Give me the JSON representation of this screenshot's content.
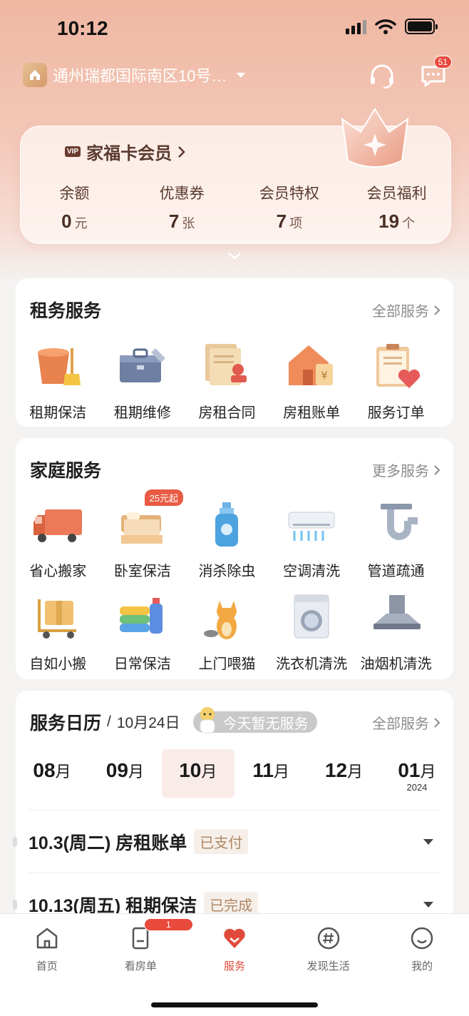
{
  "status_bar": {
    "time": "10:12"
  },
  "header": {
    "location": "通州瑞都国际南区10号…",
    "message_count": "51"
  },
  "member_card": {
    "title": "家福卡会员",
    "badge": "VIP",
    "stats": [
      {
        "label": "余额",
        "value": "0",
        "unit": "元"
      },
      {
        "label": "优惠券",
        "value": "7",
        "unit": "张"
      },
      {
        "label": "会员特权",
        "value": "7",
        "unit": "项"
      },
      {
        "label": "会员福利",
        "value": "19",
        "unit": "个"
      }
    ]
  },
  "rental_services": {
    "title": "租务服务",
    "more": "全部服务",
    "items": [
      {
        "label": "租期保洁",
        "icon": "bucket-broom-icon"
      },
      {
        "label": "租期维修",
        "icon": "toolbox-icon"
      },
      {
        "label": "房租合同",
        "icon": "contract-stamp-icon"
      },
      {
        "label": "房租账单",
        "icon": "house-bill-icon"
      },
      {
        "label": "服务订单",
        "icon": "clipboard-heart-icon"
      }
    ]
  },
  "home_services": {
    "title": "家庭服务",
    "more": "更多服务",
    "promo": "25元起",
    "row1": [
      {
        "label": "省心搬家",
        "icon": "moving-truck-icon"
      },
      {
        "label": "卧室保洁",
        "icon": "bed-icon"
      },
      {
        "label": "消杀除虫",
        "icon": "spray-bottle-icon"
      },
      {
        "label": "空调清洗",
        "icon": "air-conditioner-icon"
      },
      {
        "label": "管道疏通",
        "icon": "pipe-icon"
      }
    ],
    "row2": [
      {
        "label": "自如小搬",
        "icon": "hand-cart-icon"
      },
      {
        "label": "日常保洁",
        "icon": "towels-detergent-icon"
      },
      {
        "label": "上门喂猫",
        "icon": "cat-icon"
      },
      {
        "label": "洗衣机清洗",
        "icon": "washing-machine-icon"
      },
      {
        "label": "油烟机清洗",
        "icon": "range-hood-icon"
      }
    ]
  },
  "calendar": {
    "title": "服务日历",
    "separator": "/",
    "date": "10月24日",
    "note": "今天暂无服务",
    "more": "全部服务",
    "months": [
      {
        "num": "08",
        "unit": "月",
        "year": ""
      },
      {
        "num": "09",
        "unit": "月",
        "year": ""
      },
      {
        "num": "10",
        "unit": "月",
        "year": ""
      },
      {
        "num": "11",
        "unit": "月",
        "year": ""
      },
      {
        "num": "12",
        "unit": "月",
        "year": ""
      },
      {
        "num": "01",
        "unit": "月",
        "year": "2024"
      }
    ],
    "events": [
      {
        "text": "10.3(周二) 房租账单",
        "status": "已支付"
      },
      {
        "text": "10.13(周五) 租期保洁",
        "status": "已完成"
      }
    ]
  },
  "tabbar": {
    "badge": "1",
    "tabs": [
      {
        "label": "首页"
      },
      {
        "label": "看房单"
      },
      {
        "label": "服务"
      },
      {
        "label": "发现生活"
      },
      {
        "label": "我的"
      }
    ]
  },
  "colors": {
    "accent": "#e04a3a",
    "header_bg": "#efb7a2"
  }
}
